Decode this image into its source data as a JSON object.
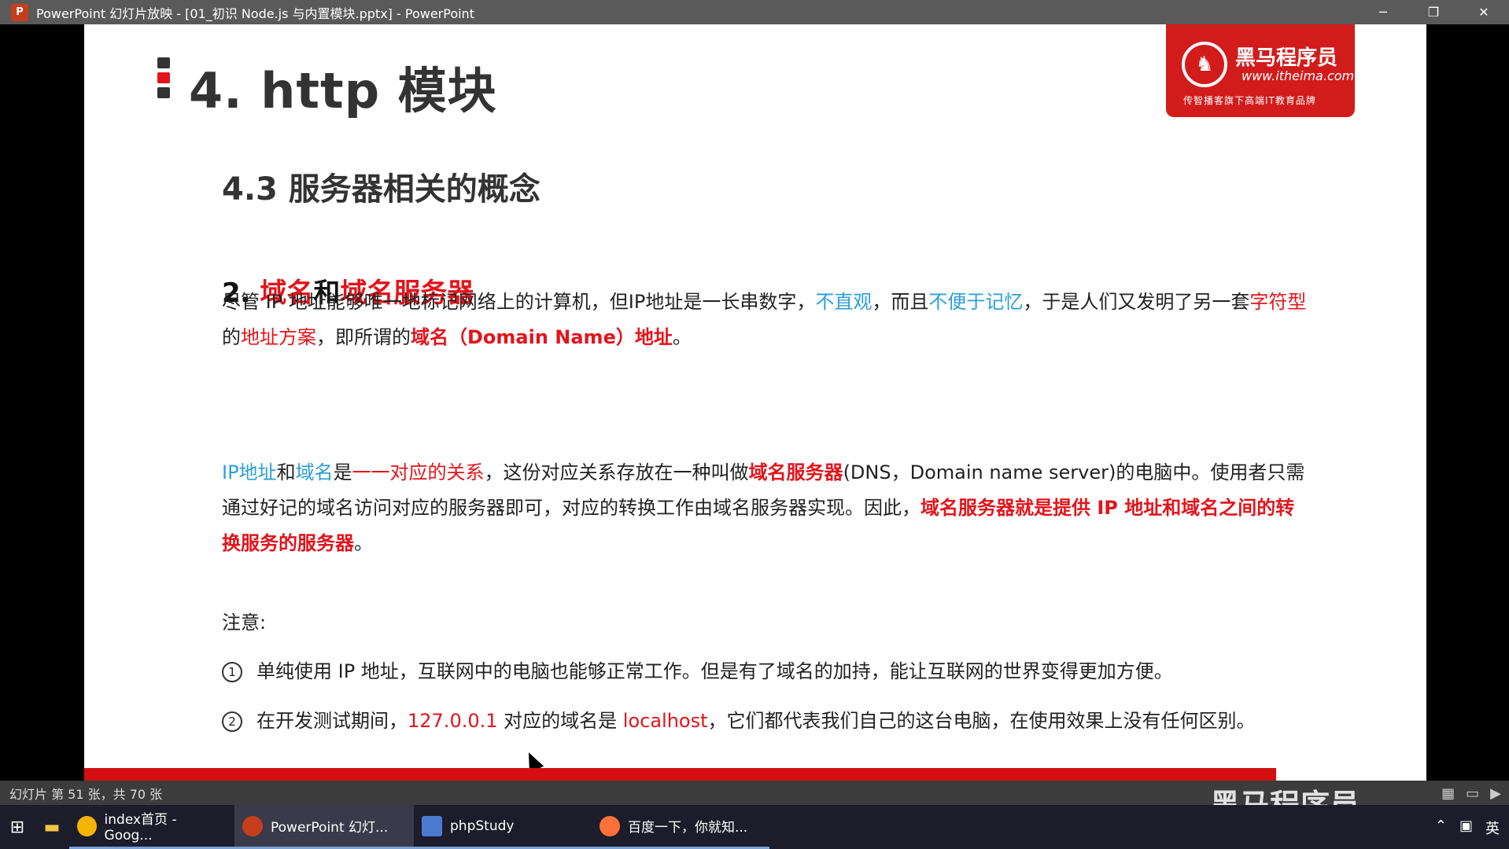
{
  "titlebar": {
    "title": "PowerPoint 幻灯片放映 - [01_初识 Node.js 与内置模块.pptx] - PowerPoint",
    "icon": "powerpoint-icon",
    "controls": [
      "─",
      "❐",
      "✕"
    ]
  },
  "slide": {
    "title": "4. http 模块",
    "logo": {
      "name": "黑马程序员",
      "url": "www.itheima.com",
      "slogan": "传智播客旗下高端IT教育品牌"
    },
    "section_title": "4.3 服务器相关的概念",
    "sub_title": {
      "prefix": "2. ",
      "part1": "域名",
      "mid": "和",
      "part2": "域名服务器"
    },
    "para1": {
      "t1": "尽管 IP 地址能够唯一地标记网络上的计算机，但IP地址是一长串数字，",
      "b1": "不直观",
      "t2": "，而且",
      "b2": "不便于记忆",
      "t3": "，于是人们又发明了另一套",
      "r1": "字符型",
      "t4": "的",
      "r2": "地址方案",
      "t5": "，即所谓的",
      "r3": "域名（Domain Name）地址",
      "t6": "。"
    },
    "para2": {
      "b1": "IP地址",
      "t1": "和",
      "b2": "域名",
      "t2": "是",
      "r1": "一一对应的关系",
      "t3": "，这份对应关系存放在一种叫做",
      "r2": "域名服务器",
      "t4": "(DNS，Domain name server)的电脑中。使用者只需通过好记的域名访问对应的服务器即可，对应的转换工作由域名服务器实现。因此，",
      "r3": "域名服务器就是提供 IP 地址和域名之间的转换服务的服务器",
      "t5": "。"
    },
    "note_label": "注意:",
    "note1": {
      "num": "1",
      "text": "单纯使用 IP 地址，互联网中的电脑也能够正常工作。但是有了域名的加持，能让互联网的世界变得更加方便。"
    },
    "note2": {
      "num": "2",
      "t1": "在开发测试期间，",
      "r1": "127.0.0.1",
      "t2": " 对应的域名是 ",
      "r2": "localhost",
      "t3": "，它们都代表我们自己的这台电脑，在使用效果上没有任何区别。"
    }
  },
  "statusbar": {
    "text": "幻灯片 第 51 张，共 70 张",
    "watermark": "黑马程序员"
  },
  "taskbar": {
    "items": [
      {
        "label": "index首页 - Goog...",
        "icon": "chrome-icon",
        "color": "#f4b400"
      },
      {
        "label": "PowerPoint 幻灯...",
        "icon": "powerpoint-icon",
        "color": "#c43e1c"
      },
      {
        "label": "phpStudy",
        "icon": "phpstudy-icon",
        "color": "#4a7bd0"
      },
      {
        "label": "百度一下，你就知...",
        "icon": "firefox-icon",
        "color": "#ff7139"
      }
    ],
    "tray_lang": "英"
  },
  "colors": {
    "accent_red": "#e3141b",
    "accent_blue": "#2a9fd6"
  }
}
